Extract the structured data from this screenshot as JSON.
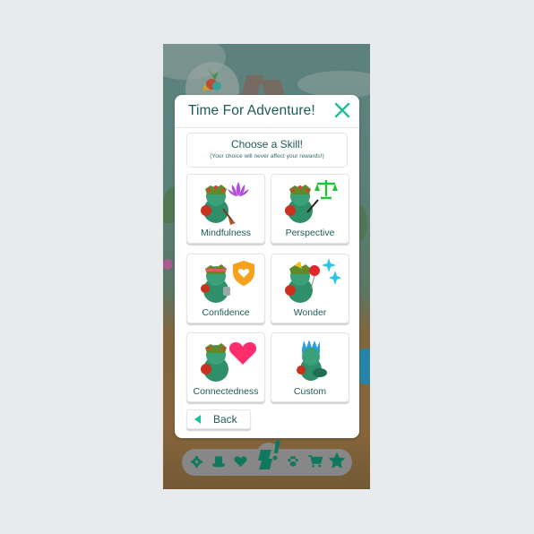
{
  "modal": {
    "title": "Time For Adventure!",
    "close_icon": "close-x-icon",
    "prompt": {
      "title": "Choose a Skill!",
      "subtitle": "(Your choice will never affect your rewards!)"
    },
    "skills": [
      {
        "label": "Mindfulness",
        "icon": "lotus-icon",
        "color": "#b24fd6"
      },
      {
        "label": "Perspective",
        "icon": "scales-icon",
        "color": "#22c43a"
      },
      {
        "label": "Confidence",
        "icon": "shield-heart-icon",
        "color": "#f5a21a"
      },
      {
        "label": "Wonder",
        "icon": "sparkle-balloon-icon",
        "color": "#29c7e6"
      },
      {
        "label": "Connectedness",
        "icon": "heart-icon",
        "color": "#ff2d6c"
      },
      {
        "label": "Custom",
        "icon": "ukulele-icon",
        "color": "#1aa0d8"
      }
    ],
    "back_label": "Back"
  },
  "navbar": {
    "items": [
      {
        "name": "settings",
        "icon": "gear-icon"
      },
      {
        "name": "wardrobe",
        "icon": "top-hat-icon"
      },
      {
        "name": "favorites",
        "icon": "heart-icon"
      },
      {
        "name": "quests",
        "icon": "scroll-alert-icon"
      },
      {
        "name": "pets",
        "icon": "paw-icon"
      },
      {
        "name": "shop",
        "icon": "cart-icon"
      },
      {
        "name": "achievements",
        "icon": "star-icon"
      }
    ]
  },
  "colors": {
    "accent": "#1fbf9a",
    "text": "#1f5a57",
    "nav_icon": "#11785f"
  }
}
